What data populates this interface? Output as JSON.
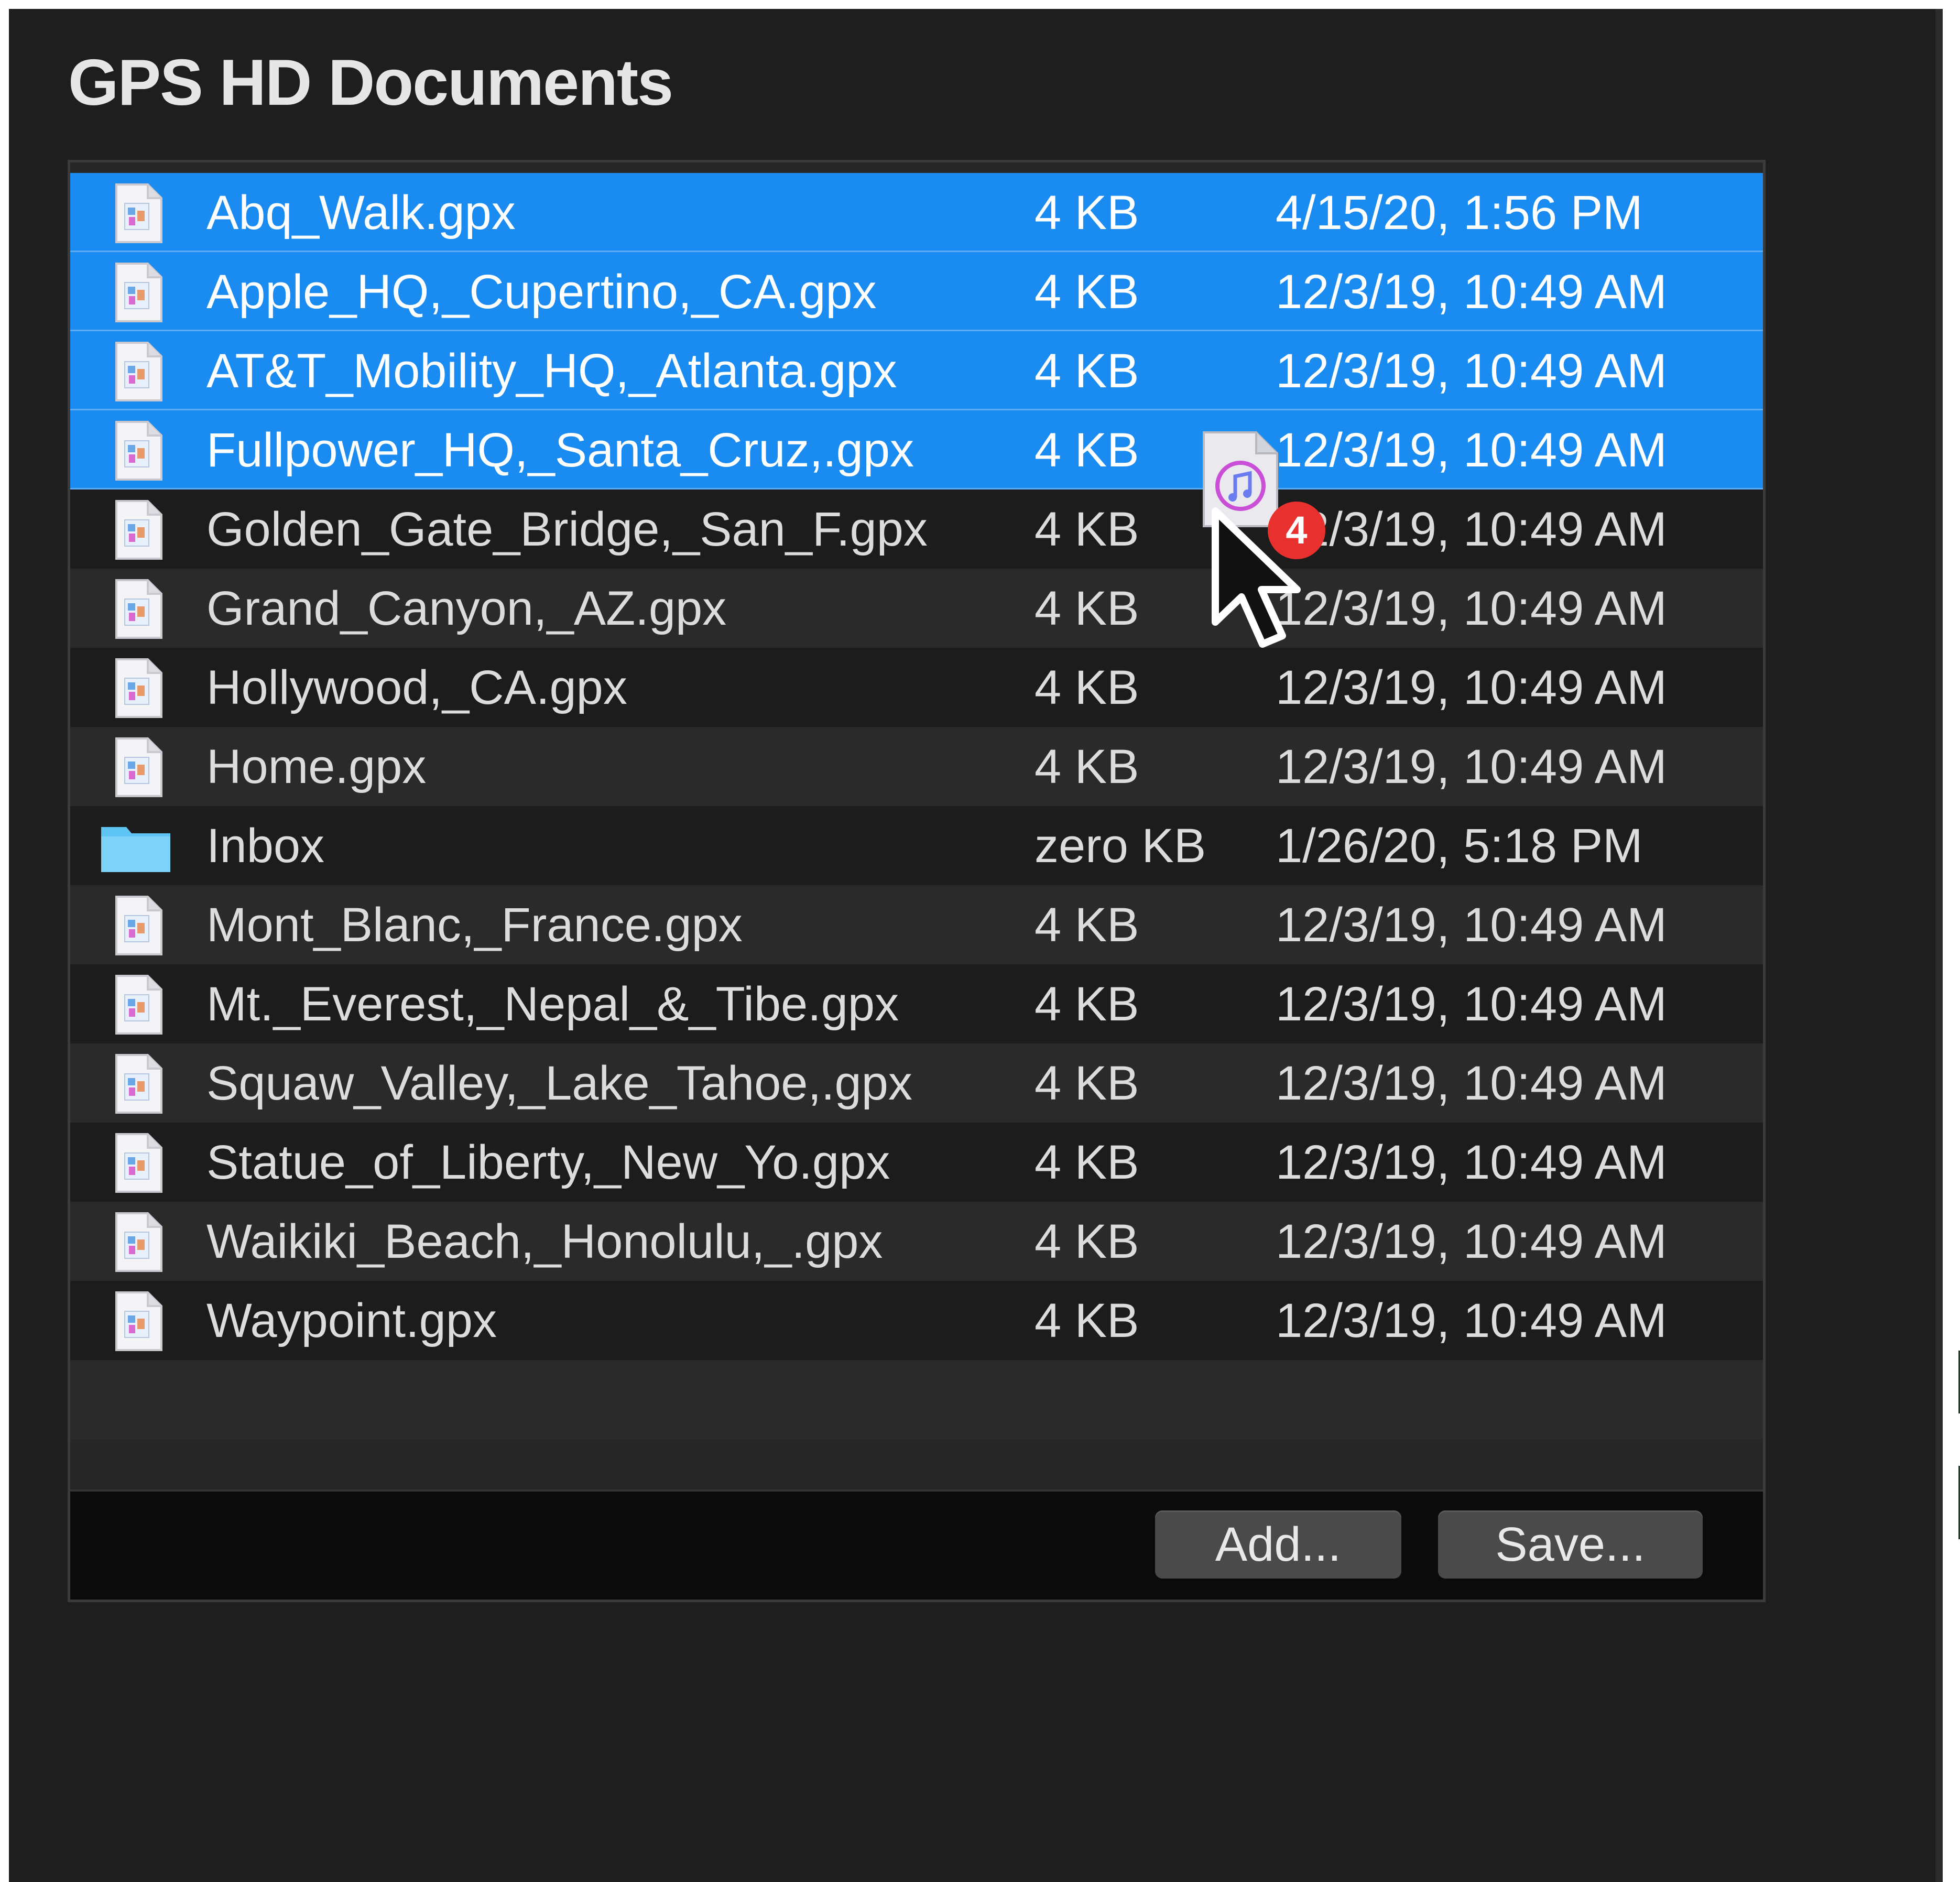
{
  "window": {
    "title": "GPS HD Documents"
  },
  "files": [
    {
      "name": "Abq_Walk.gpx",
      "size": "4 KB",
      "date": "4/15/20, 1:56 PM",
      "selected": true,
      "kind": "gpx"
    },
    {
      "name": "Apple_HQ,_Cupertino,_CA.gpx",
      "size": "4 KB",
      "date": "12/3/19, 10:49 AM",
      "selected": true,
      "kind": "gpx"
    },
    {
      "name": "AT&T_Mobility_HQ,_Atlanta.gpx",
      "size": "4 KB",
      "date": "12/3/19, 10:49 AM",
      "selected": true,
      "kind": "gpx"
    },
    {
      "name": "Fullpower_HQ,_Santa_Cruz,.gpx",
      "size": "4 KB",
      "date": "12/3/19, 10:49 AM",
      "selected": true,
      "kind": "gpx"
    },
    {
      "name": "Golden_Gate_Bridge,_San_F.gpx",
      "size": "4 KB",
      "date": "12/3/19, 10:49 AM",
      "selected": false,
      "kind": "gpx"
    },
    {
      "name": "Grand_Canyon,_AZ.gpx",
      "size": "4 KB",
      "date": "12/3/19, 10:49 AM",
      "selected": false,
      "kind": "gpx"
    },
    {
      "name": "Hollywood,_CA.gpx",
      "size": "4 KB",
      "date": "12/3/19, 10:49 AM",
      "selected": false,
      "kind": "gpx"
    },
    {
      "name": "Home.gpx",
      "size": "4 KB",
      "date": "12/3/19, 10:49 AM",
      "selected": false,
      "kind": "gpx"
    },
    {
      "name": "Inbox",
      "size": "zero KB",
      "date": "1/26/20, 5:18 PM",
      "selected": false,
      "kind": "folder"
    },
    {
      "name": "Mont_Blanc,_France.gpx",
      "size": "4 KB",
      "date": "12/3/19, 10:49 AM",
      "selected": false,
      "kind": "gpx"
    },
    {
      "name": "Mt._Everest,_Nepal_&_Tibe.gpx",
      "size": "4 KB",
      "date": "12/3/19, 10:49 AM",
      "selected": false,
      "kind": "gpx"
    },
    {
      "name": "Squaw_Valley,_Lake_Tahoe,.gpx",
      "size": "4 KB",
      "date": "12/3/19, 10:49 AM",
      "selected": false,
      "kind": "gpx"
    },
    {
      "name": "Statue_of_Liberty,_New_Yo.gpx",
      "size": "4 KB",
      "date": "12/3/19, 10:49 AM",
      "selected": false,
      "kind": "gpx"
    },
    {
      "name": "Waikiki_Beach,_Honolulu,_.gpx",
      "size": "4 KB",
      "date": "12/3/19, 10:49 AM",
      "selected": false,
      "kind": "gpx"
    },
    {
      "name": "Waypoint.gpx",
      "size": "4 KB",
      "date": "12/3/19, 10:49 AM",
      "selected": false,
      "kind": "gpx"
    }
  ],
  "buttons": {
    "add_label": "Add...",
    "save_label": "Save..."
  },
  "drag": {
    "badge_count": "4",
    "drag_icon": "music-document-icon",
    "cursor_icon": "arrow-cursor-icon"
  },
  "colors": {
    "window_bg": "#1e1e1e",
    "selection": "#1a8bf0",
    "row_dark": "#1c1c1c",
    "row_alt": "#2a2a2a",
    "badge": "#e8312f",
    "folder": "#5ec4f4"
  }
}
